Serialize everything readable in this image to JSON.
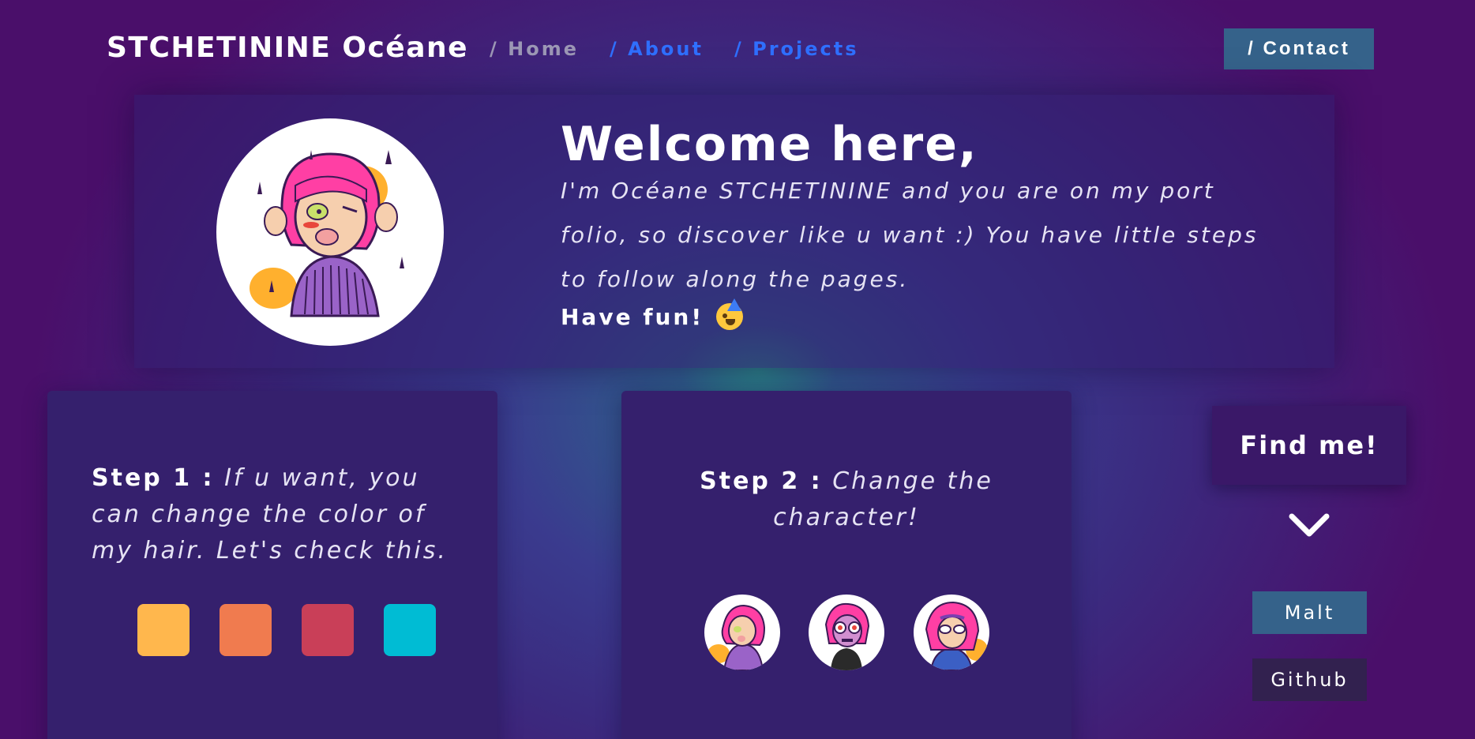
{
  "header": {
    "brand": "STCHETININE Océane",
    "nav": {
      "home": "/ Home",
      "about": "/ About",
      "projects": "/ Projects"
    },
    "contact_label": "/ Contact"
  },
  "welcome": {
    "title": "Welcome here,",
    "text": "I'm Océane STCHETININE and you are on my port folio, so discover like u want :) You have little steps to follow along the pages.",
    "fun": "Have fun!",
    "emoji": "partying-face-emoji"
  },
  "step1": {
    "label": "Step 1 :",
    "text": "If u want, you can change the color of my hair. Let's check this.",
    "swatches": [
      "#ffb74d",
      "#f07b4f",
      "#c93f58",
      "#00bcd4"
    ]
  },
  "step2": {
    "label": "Step 2 :",
    "text": "Change the character!",
    "characters": [
      "character-1",
      "character-2",
      "character-3"
    ]
  },
  "findme": {
    "title": "Find me!",
    "icon": "chevron-down-icon",
    "links": {
      "malt": "Malt",
      "github": "Github"
    }
  },
  "colors": {
    "accent_blue": "#2f6fff",
    "button_blue": "#35628a",
    "card_bg": "#35206d",
    "hair_pink": "#ff3fa4"
  }
}
